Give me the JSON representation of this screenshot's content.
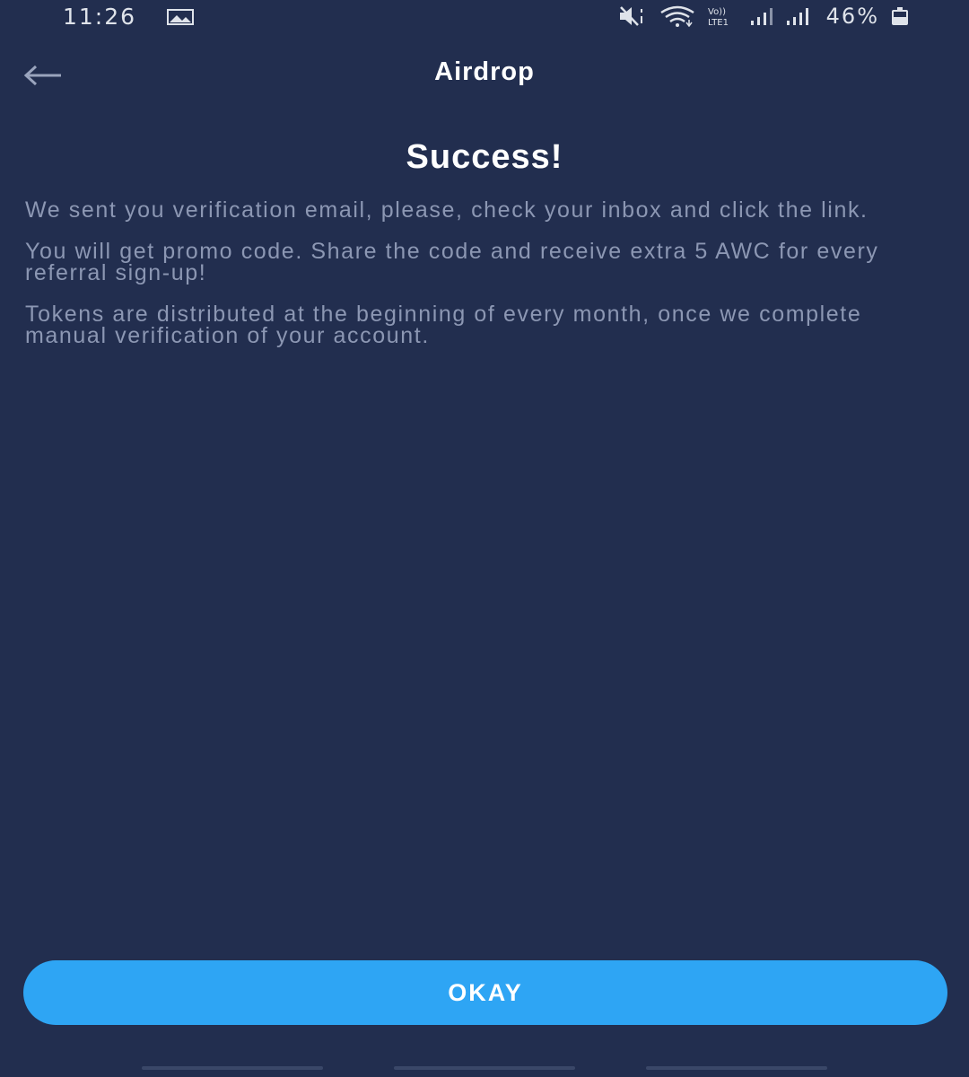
{
  "status_bar": {
    "time": "11:26",
    "battery_percent": "46%",
    "icons": [
      "gallery-icon",
      "mute-icon",
      "wifi-icon",
      "volte-icon",
      "signal-icon",
      "signal-icon",
      "battery-icon"
    ]
  },
  "app_bar": {
    "title": "Airdrop",
    "back_icon": "arrow-left-icon"
  },
  "content": {
    "headline": "Success!",
    "paragraphs": [
      "We sent you verification email, please, check your inbox and click the link.",
      "You will get promo code. Share the code and receive extra 5 AWC for every referral sign-up!",
      "Tokens are distributed at the beginning of every month, once we complete manual verification of your account."
    ]
  },
  "actions": {
    "okay_label": "OKAY"
  },
  "colors": {
    "background": "#222e4f",
    "accent": "#2ea5f4",
    "body_text": "#8c97b3"
  }
}
